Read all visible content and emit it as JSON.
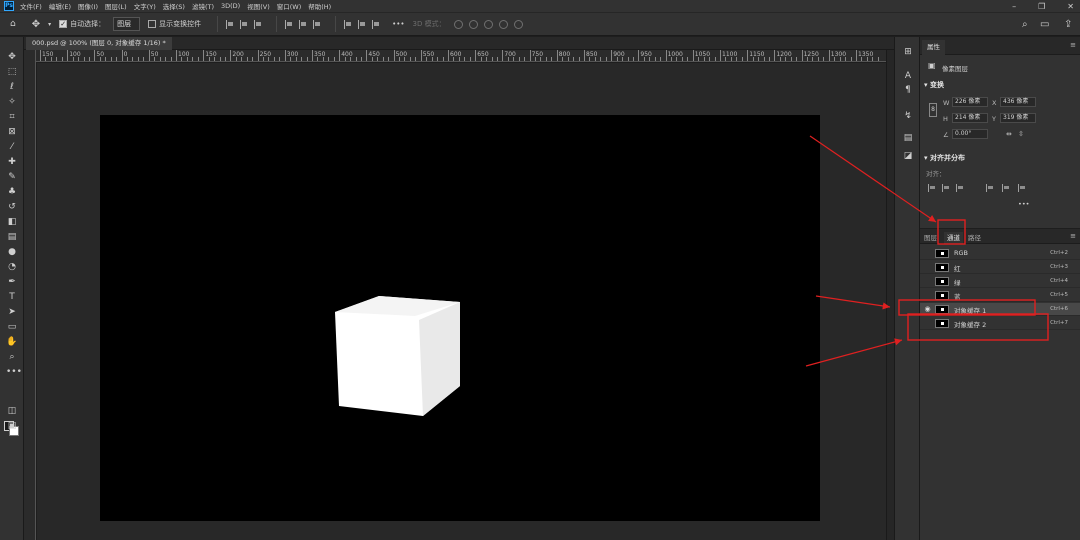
{
  "menubar": {
    "logo": "Ps",
    "items": [
      "文件(F)",
      "编辑(E)",
      "图像(I)",
      "图层(L)",
      "文字(Y)",
      "选择(S)",
      "滤镜(T)",
      "3D(D)",
      "视图(V)",
      "窗口(W)",
      "帮助(H)"
    ]
  },
  "options": {
    "auto_select_label": "自动选择：",
    "auto_select_value": "图层",
    "show_transform_label": "显示变换控件",
    "mode_3d_label": "3D 模式："
  },
  "document": {
    "tab_label": "000.psd @ 100% (图层 0, 对象缓存 1/16) *",
    "ruler_labels": [
      "150",
      "100",
      "50",
      "0",
      "50",
      "100",
      "150",
      "200",
      "250",
      "300",
      "350",
      "400",
      "450",
      "500",
      "550",
      "600",
      "650",
      "700",
      "750",
      "800",
      "850",
      "900",
      "950",
      "1000",
      "1050",
      "1100",
      "1150",
      "1200",
      "1250",
      "1300",
      "1350"
    ]
  },
  "properties": {
    "tab_label": "属性",
    "layer_type": "像素图层",
    "transform_header": "变换",
    "w_label": "W",
    "w_value": "226 像素",
    "x_label": "X",
    "x_value": "436 像素",
    "h_label": "H",
    "h_value": "214 像素",
    "y_label": "Y",
    "y_value": "319 像素",
    "angle_value": "0.00°",
    "align_header": "对齐并分布",
    "align_label": "对齐：",
    "more_dots": "•••"
  },
  "channels": {
    "tabs": [
      "图层",
      "通道",
      "路径"
    ],
    "active_tab": "通道",
    "rows": [
      {
        "name": "RGB",
        "shortcut": "Ctrl+2",
        "visible": false,
        "selected": false
      },
      {
        "name": "红",
        "shortcut": "Ctrl+3",
        "visible": false,
        "selected": false
      },
      {
        "name": "绿",
        "shortcut": "Ctrl+4",
        "visible": false,
        "selected": false
      },
      {
        "name": "蓝",
        "shortcut": "Ctrl+5",
        "visible": false,
        "selected": false
      },
      {
        "name": "对象缓存 1",
        "shortcut": "Ctrl+6",
        "visible": true,
        "selected": true
      },
      {
        "name": "对象缓存 2",
        "shortcut": "Ctrl+7",
        "visible": false,
        "selected": false
      }
    ]
  },
  "colors": {
    "ui_dark": "#323232",
    "canvas_bg": "#282828",
    "annotation_red": "#e02020"
  }
}
